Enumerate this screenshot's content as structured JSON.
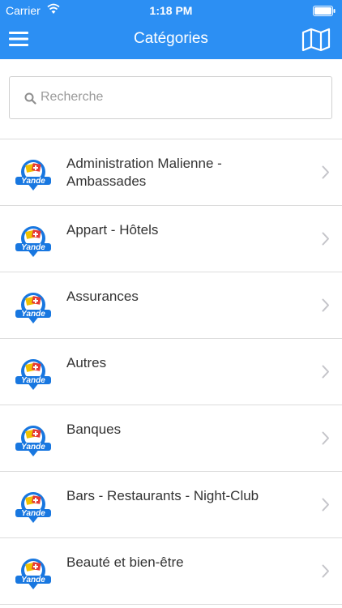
{
  "status_bar": {
    "carrier": "Carrier",
    "time": "1:18 PM"
  },
  "nav": {
    "title": "Catégories",
    "left_icon": "hamburger-menu-icon",
    "right_icon": "map-icon",
    "bar_color": "#2c8ff3"
  },
  "search": {
    "placeholder": "Recherche",
    "value": ""
  },
  "categories": [
    {
      "label": "Administration Malienne -\nAmbassades"
    },
    {
      "label": "Appart - Hôtels"
    },
    {
      "label": "Assurances"
    },
    {
      "label": "Autres"
    },
    {
      "label": "Banques"
    },
    {
      "label": "Bars - Restaurants - Night-Club"
    },
    {
      "label": "Beauté et bien-être"
    }
  ],
  "brand": {
    "logo_text": "Yande"
  }
}
